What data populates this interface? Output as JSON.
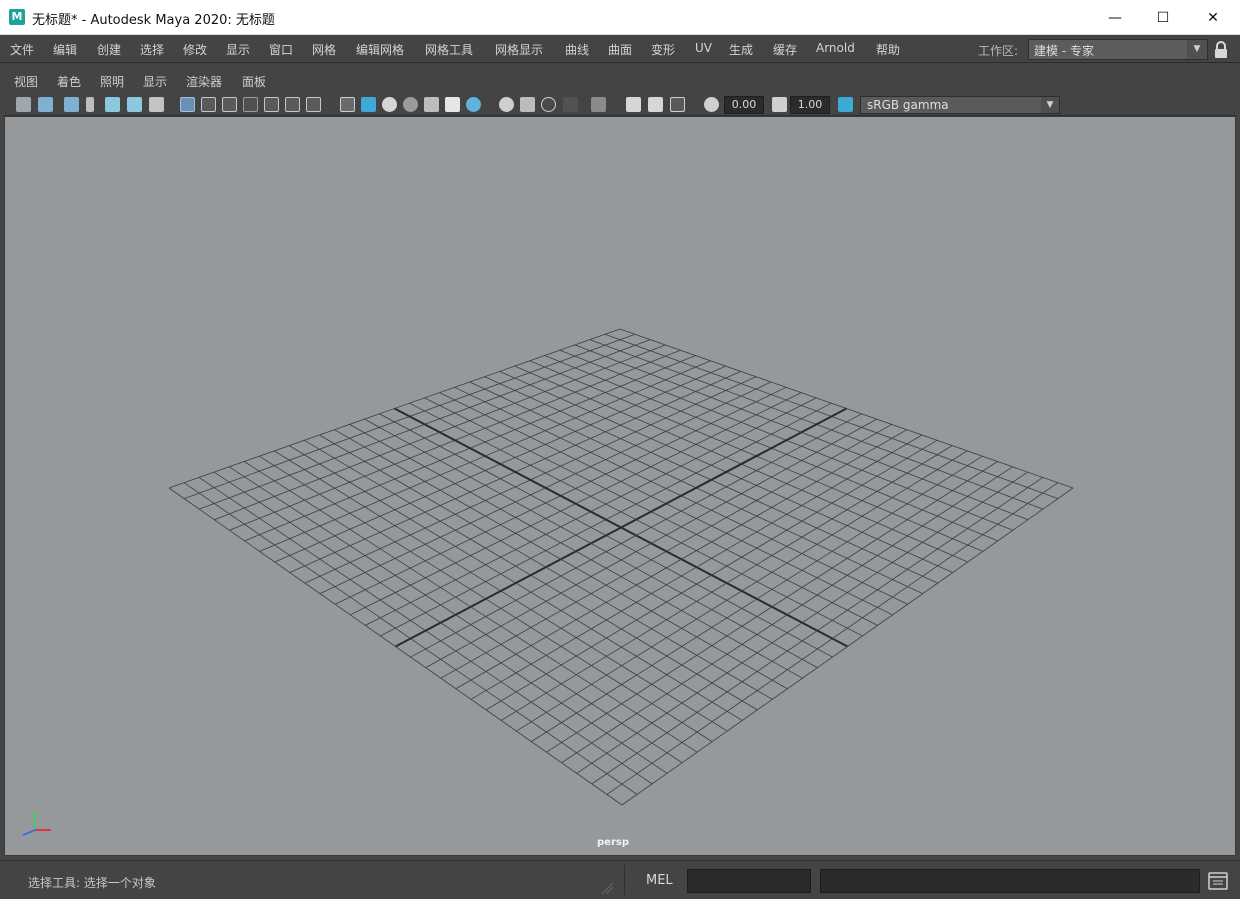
{
  "window": {
    "title": "无标题* - Autodesk Maya 2020: 无标题",
    "app_icon_letter": "M",
    "minimize_glyph": "—",
    "maximize_glyph": "☐",
    "close_glyph": "✕"
  },
  "main_menu": {
    "items": [
      "文件",
      "编辑",
      "创建",
      "选择",
      "修改",
      "显示",
      "窗口",
      "网格",
      "编辑网格",
      "网格工具",
      "网格显示",
      "曲线",
      "曲面",
      "变形",
      "UV",
      "生成",
      "缓存",
      "Arnold",
      "帮助"
    ],
    "workspace_label": "工作区:",
    "workspace_value": "建模 - 专家"
  },
  "panel_menu": {
    "items": [
      "视图",
      "着色",
      "照明",
      "显示",
      "渲染器",
      "面板"
    ]
  },
  "toolbar": {
    "exposure_value": "0.00",
    "gamma_value": "1.00",
    "color_space": "sRGB gamma",
    "icons": [
      "select-camera-icon",
      "camera-attributes-icon",
      "bookmark-icon",
      "image-plane-icon",
      "2d-pan-zoom-icon",
      "grease-pencil-icon",
      "grid-icon",
      "film-gate-icon",
      "resolution-gate-icon",
      "gate-mask-icon",
      "field-chart-icon",
      "safe-action-icon",
      "safe-title-icon",
      "wireframe-icon",
      "smooth-shade-icon",
      "default-material-icon",
      "textured-icon",
      "lights-icon",
      "shadows-icon",
      "ambient-occlusion-icon",
      "motion-blur-icon",
      "anti-aliasing-icon",
      "depth-of-field-icon",
      "isolate-select-icon",
      "xray-icon",
      "xray-joints-icon",
      "backface-culling-icon",
      "exposure-icon",
      "gamma-icon",
      "color-management-icon"
    ]
  },
  "viewport": {
    "camera_name": "persp",
    "background_color": "#96999b",
    "grid_color": "#3c3d3e",
    "axis_colors": {
      "x": "#e0383a",
      "y": "#38d26a",
      "z": "#3a6ee6"
    }
  },
  "status": {
    "help_line": "选择工具: 选择一个对象",
    "command_language": "MEL",
    "command_value": "",
    "result_value": ""
  }
}
